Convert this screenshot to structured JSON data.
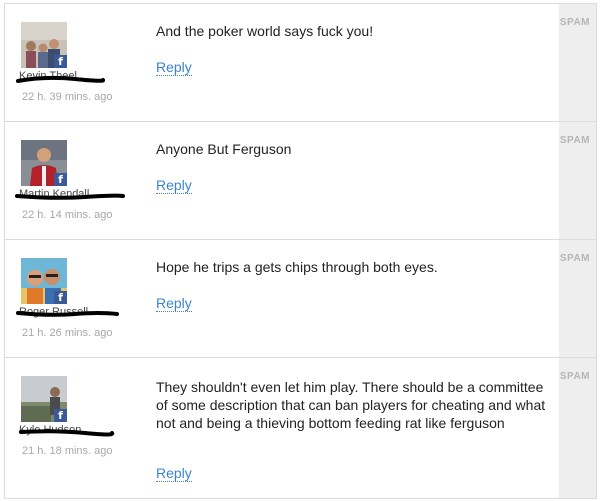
{
  "comments": [
    {
      "author": "Kevin Theel",
      "time": "22 h. 39 mins. ago",
      "text": "And the poker world says fuck you!",
      "reply": "Reply",
      "spam": "SPAM",
      "avatar": "family-photo"
    },
    {
      "author": "Martin Kendall",
      "time": "22 h. 14 mins. ago",
      "text": "Anyone But Ferguson",
      "reply": "Reply",
      "spam": "SPAM",
      "avatar": "man-red-jacket-photo"
    },
    {
      "author": "Roger Russell",
      "time": "21 h. 26 mins. ago",
      "text": "Hope he trips a gets chips through both eyes.",
      "reply": "Reply",
      "spam": "SPAM",
      "avatar": "couple-sunglasses-photo"
    },
    {
      "author": "Kyle Hudson",
      "time": "21 h. 18 mins. ago",
      "text": "They shouldn't even let him play. There should be a committee of some description that can ban players for cheating and what not and being a thieving bottom feeding rat like ferguson",
      "reply": "Reply",
      "spam": "SPAM",
      "avatar": "outdoor-view-photo"
    }
  ],
  "facebook_glyph": "f"
}
